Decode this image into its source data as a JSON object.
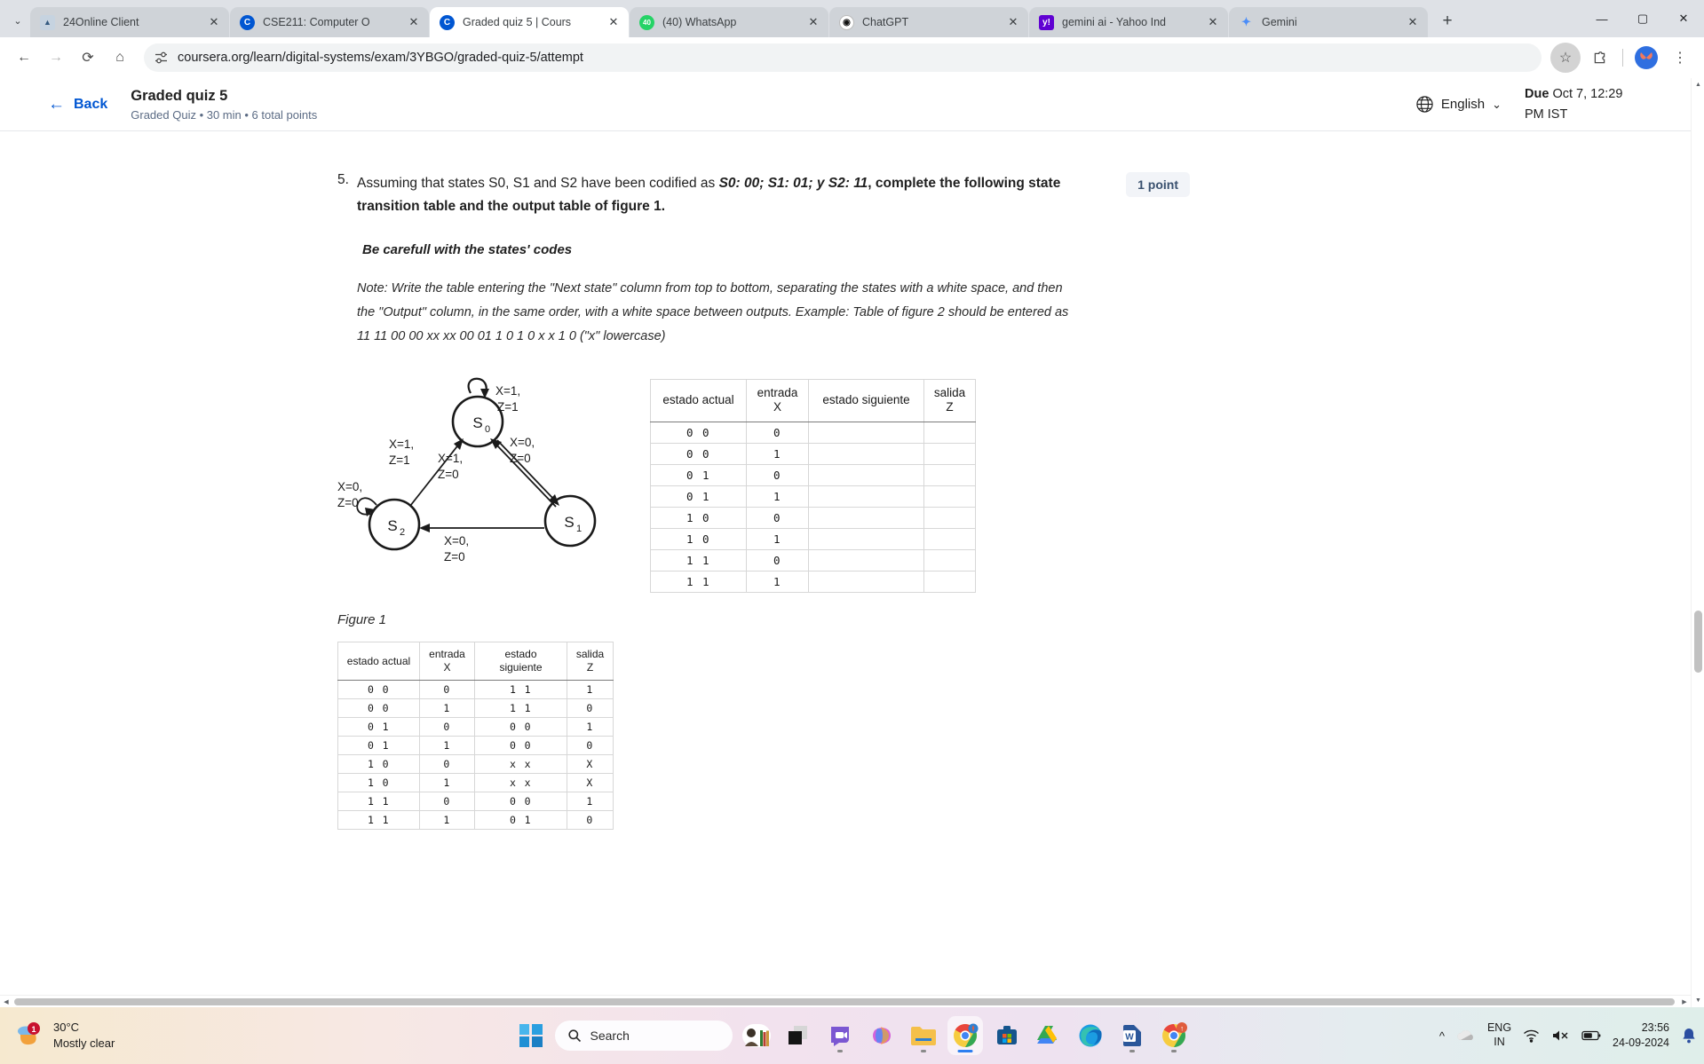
{
  "browser": {
    "tabs": [
      {
        "title": "24Online Client",
        "favicon": "24online-icon",
        "color": "#8fa6bd",
        "glyph": "▲",
        "active": false
      },
      {
        "title": "CSE211: Computer O",
        "favicon": "coursera-icon",
        "color": "#0056d2",
        "glyph": "C",
        "active": false
      },
      {
        "title": "Graded quiz 5 | Cours",
        "favicon": "coursera-icon",
        "color": "#0056d2",
        "glyph": "C",
        "active": true
      },
      {
        "title": "(40) WhatsApp",
        "favicon": "whatsapp-icon",
        "color": "#25d366",
        "glyph": "40",
        "active": false
      },
      {
        "title": "ChatGPT",
        "favicon": "chatgpt-icon",
        "color": "#ffffff",
        "glyph": "◉",
        "active": false
      },
      {
        "title": "gemini ai - Yahoo Ind",
        "favicon": "yahoo-icon",
        "color": "#6001d2",
        "glyph": "y!",
        "active": false
      },
      {
        "title": "Gemini",
        "favicon": "gemini-icon",
        "color": "#ffffff",
        "glyph": "✦",
        "active": false
      }
    ],
    "new_tab_label": "+",
    "tab_search_label": "⌄",
    "window_controls": {
      "minimize": "—",
      "maximize": "▢",
      "close": "✕"
    },
    "nav": {
      "back": "←",
      "forward": "→",
      "reload": "⟳",
      "home": "⌂"
    },
    "url": "coursera.org/learn/digital-systems/exam/3YBGO/graded-quiz-5/attempt",
    "site_info_icon": "tune-icon",
    "bookmark_icon": "☆",
    "extensions_icon": "puzzle-icon",
    "menu_icon": "⋮"
  },
  "quiz_header": {
    "back_label": "Back",
    "back_arrow": "←",
    "title": "Graded quiz 5",
    "subtitle": "Graded Quiz • 30 min • 6 total points",
    "language": "English",
    "language_chevron": "⌄",
    "globe_icon": "globe-icon",
    "due_label": "Due",
    "due_value": "Oct 7, 12:29 PM IST"
  },
  "question": {
    "number": "5.",
    "points_badge": "1 point",
    "text_part1": "Assuming that states S0, S1 and S2 have been codified as ",
    "text_bold_italic": "S0: 00; S1: 01; y S2: 11",
    "text_part2": ", complete the following state transition table and the output table of figure 1.",
    "warning": "Be carefull with the states' codes",
    "note": "Note: Write the table entering the \"Next state\" column from top to bottom, separating the states with a white space, and then the \"Output\" column, in the same order, with a white space between outputs. Example: Table of figure 2 should be entered as 11 11 00 00 xx xx 00 01 1 0 1 0 x x 1 0 (\"x\" lowercase)",
    "figure_caption": "Figure 1"
  },
  "state_diagram": {
    "states": [
      "S0",
      "S1",
      "S2"
    ],
    "transitions": [
      {
        "from": "S0",
        "to": "S0",
        "label": "X=1,\nZ=1",
        "label_line1": "X=1,",
        "label_line2": "Z=1"
      },
      {
        "from": "S0",
        "to": "S1",
        "label_line1": "X=0,",
        "label_line2": "Z=0"
      },
      {
        "from": "S1",
        "to": "S0",
        "label_line1": "X=1,",
        "label_line2": "Z=0"
      },
      {
        "from": "S1",
        "to": "S2",
        "label_line1": "X=0,",
        "label_line2": "Z=0"
      },
      {
        "from": "S2",
        "to": "S0",
        "label_line1": "X=1,",
        "label_line2": "Z=1"
      },
      {
        "from": "S2",
        "to": "S2",
        "label_line1": "X=0,",
        "label_line2": "Z=0"
      }
    ]
  },
  "table_blank": {
    "headers": [
      "estado actual",
      "entrada\nX",
      "estado siguiente",
      "salida\nZ"
    ],
    "header_cells": [
      {
        "l1": "estado actual",
        "l2": ""
      },
      {
        "l1": "entrada",
        "l2": "X"
      },
      {
        "l1": "estado siguiente",
        "l2": ""
      },
      {
        "l1": "salida",
        "l2": "Z"
      }
    ],
    "rows": [
      [
        "0 0",
        "0",
        "",
        ""
      ],
      [
        "0 0",
        "1",
        "",
        ""
      ],
      [
        "0 1",
        "0",
        "",
        ""
      ],
      [
        "0 1",
        "1",
        "",
        ""
      ],
      [
        "1 0",
        "0",
        "",
        ""
      ],
      [
        "1 0",
        "1",
        "",
        ""
      ],
      [
        "1 1",
        "0",
        "",
        ""
      ],
      [
        "1 1",
        "1",
        "",
        ""
      ]
    ]
  },
  "table_figure2": {
    "header_cells": [
      {
        "l1": "estado actual",
        "l2": ""
      },
      {
        "l1": "entrada",
        "l2": "X"
      },
      {
        "l1": "estado siguiente",
        "l2": ""
      },
      {
        "l1": "salida",
        "l2": "Z"
      }
    ],
    "rows": [
      [
        "0 0",
        "0",
        "1 1",
        "1"
      ],
      [
        "0 0",
        "1",
        "1 1",
        "0"
      ],
      [
        "0 1",
        "0",
        "0 0",
        "1"
      ],
      [
        "0 1",
        "1",
        "0 0",
        "0"
      ],
      [
        "1 0",
        "0",
        "x x",
        "X"
      ],
      [
        "1 0",
        "1",
        "x x",
        "X"
      ],
      [
        "1 1",
        "0",
        "0 0",
        "1"
      ],
      [
        "1 1",
        "1",
        "0 1",
        "0"
      ]
    ]
  },
  "taskbar": {
    "weather_temp": "30°C",
    "weather_desc": "Mostly clear",
    "weather_badge": "1",
    "search_placeholder": "Search",
    "search_icon": "search-icon",
    "start_icon": "windows-start-icon",
    "apps": [
      {
        "name": "people-photo-icon",
        "active": false
      },
      {
        "name": "dark-squares-icon",
        "active": false
      },
      {
        "name": "teams-icon",
        "active": false
      },
      {
        "name": "copilot-icon",
        "active": false
      },
      {
        "name": "file-explorer-icon",
        "active": false
      },
      {
        "name": "chrome-icon",
        "active": true
      },
      {
        "name": "microsoft-store-icon",
        "active": false
      },
      {
        "name": "google-drive-icon",
        "active": false
      },
      {
        "name": "edge-icon",
        "active": false
      },
      {
        "name": "word-icon",
        "active": false
      },
      {
        "name": "chrome-secondary-icon",
        "active": false
      }
    ],
    "tray": {
      "chevron": "^",
      "cloud_icon": "onedrive-icon",
      "language": "ENG",
      "region": "IN",
      "wifi_icon": "wifi-icon",
      "volume_icon": "volume-muted-icon",
      "battery_icon": "battery-icon",
      "time": "23:56",
      "date": "24-09-2024",
      "notification_icon": "bell-icon"
    }
  }
}
